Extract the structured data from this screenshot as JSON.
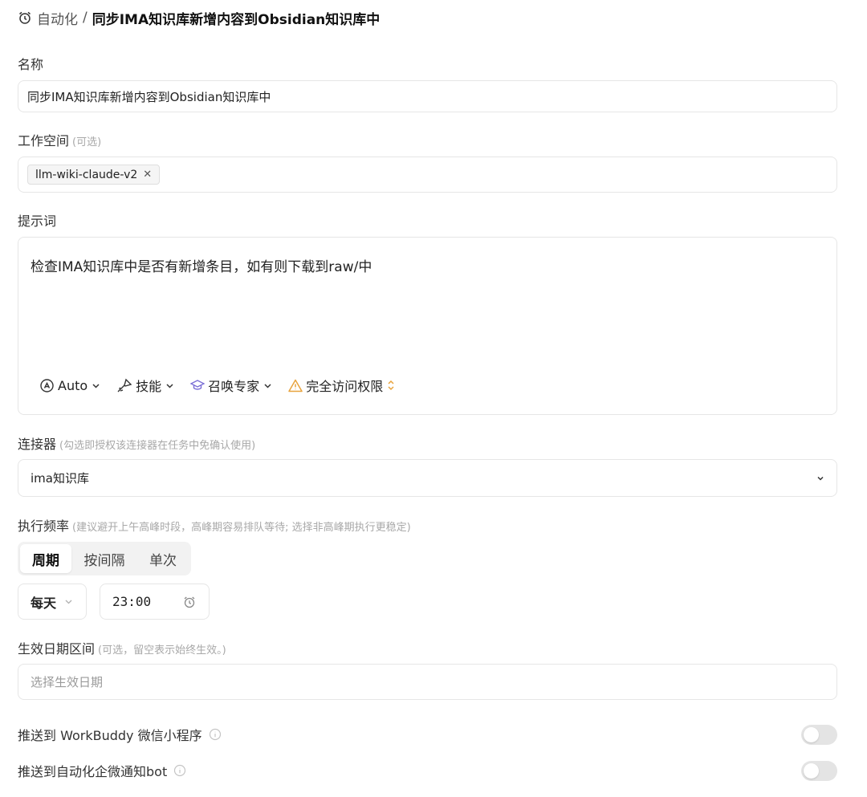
{
  "breadcrumb": {
    "root": "自动化",
    "separator": "/",
    "current": "同步IMA知识库新增内容到Obsidian知识库中"
  },
  "name": {
    "label": "名称",
    "value": "同步IMA知识库新增内容到Obsidian知识库中"
  },
  "workspace": {
    "label": "工作空间",
    "hint": "(可选)",
    "tags": [
      "llm-wiki-claude-v2"
    ],
    "remove_glyph": "✕"
  },
  "prompt": {
    "label": "提示词",
    "value": "检查IMA知识库中是否有新增条目，如有则下载到raw/中",
    "toolbar": {
      "model": "Auto",
      "skills": "技能",
      "expert": "召唤专家",
      "access": "完全访问权限"
    }
  },
  "connector": {
    "label": "连接器",
    "hint": "(勾选即授权该连接器在任务中免确认使用)",
    "value": "ima知识库"
  },
  "frequency": {
    "label": "执行频率",
    "hint": "(建议避开上午高峰时段，高峰期容易排队等待; 选择非高峰期执行更稳定)",
    "tabs": [
      "周期",
      "按间隔",
      "单次"
    ],
    "active_tab": "周期",
    "period": "每天",
    "time": "23:00"
  },
  "date_range": {
    "label": "生效日期区间",
    "hint": "(可选，留空表示始终生效。)",
    "placeholder": "选择生效日期"
  },
  "push": [
    {
      "label": "推送到 WorkBuddy 微信小程序",
      "enabled": false
    },
    {
      "label": "推送到自动化企微通知bot",
      "enabled": false
    }
  ],
  "colors": {
    "warning": "#e8a33d",
    "expert": "#7b6fd6",
    "toggle_off": "#e4e4e4"
  }
}
